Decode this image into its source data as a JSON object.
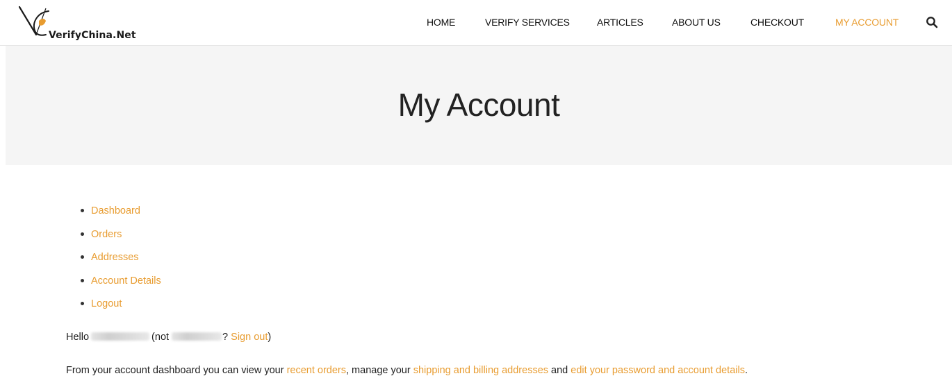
{
  "header": {
    "logo_text": "VerifyChina.Net",
    "nav": [
      {
        "label": "HOME",
        "active": false
      },
      {
        "label": "VERIFY SERVICES",
        "active": false
      },
      {
        "label": "ARTICLES",
        "active": false
      },
      {
        "label": "ABOUT US",
        "active": false
      },
      {
        "label": "CHECKOUT",
        "active": false
      },
      {
        "label": "MY ACCOUNT",
        "active": true
      }
    ],
    "search_icon": "search-icon"
  },
  "page": {
    "title": "My Account"
  },
  "account_nav": [
    {
      "label": "Dashboard"
    },
    {
      "label": "Orders"
    },
    {
      "label": "Addresses"
    },
    {
      "label": "Account Details"
    },
    {
      "label": "Logout"
    }
  ],
  "greeting": {
    "hello": "Hello",
    "not_prefix": "(not",
    "question": "?",
    "sign_out": "Sign out",
    "close_paren": ")"
  },
  "description": {
    "intro": "From your account dashboard you can view your",
    "recent_orders": "recent orders",
    "manage": ", manage your",
    "addresses": "shipping and billing addresses",
    "and": "and",
    "account_details": "edit your password and account details",
    "period": "."
  },
  "colors": {
    "accent": "#e89c30",
    "title_band": "#f5f5f5",
    "text": "#1e1e1e"
  }
}
